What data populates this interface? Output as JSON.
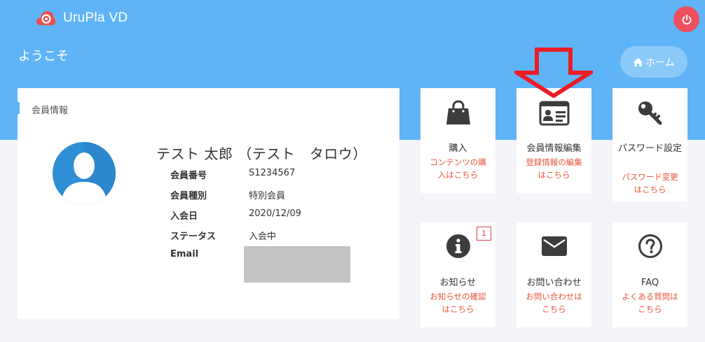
{
  "app": {
    "name": "UruPla VD"
  },
  "header": {
    "welcome": "ようこそ",
    "home_label": "ホーム"
  },
  "member_card": {
    "title": "会員情報",
    "name": "テスト 太郎 （テスト　タロウ）",
    "fields": [
      {
        "label": "会員番号",
        "value": "S1234567"
      },
      {
        "label": "会員種別",
        "value": "特別会員"
      },
      {
        "label": "入会日",
        "value": "2020/12/09"
      },
      {
        "label": "ステータス",
        "value": "入会中"
      },
      {
        "label": "Email",
        "value": ""
      }
    ]
  },
  "tiles": [
    {
      "id": "purchase",
      "icon": "shopping-bag-icon",
      "label": "購入",
      "desc": "コンテンツの購入はこちら"
    },
    {
      "id": "member-edit",
      "icon": "id-card-icon",
      "label": "会員情報編集",
      "desc": "登録情報の編集はこちら"
    },
    {
      "id": "password",
      "icon": "key-icon",
      "label": "パスワード設定",
      "desc": "パスワード変更はこちら"
    },
    {
      "id": "notice",
      "icon": "info-circle-icon",
      "label": "お知らせ",
      "desc": "お知らせの確認はこちら",
      "badge": "1"
    },
    {
      "id": "contact",
      "icon": "envelope-icon",
      "label": "お問い合わせ",
      "desc": "お問い合わせはこちら"
    },
    {
      "id": "faq",
      "icon": "question-circle-icon",
      "label": "FAQ",
      "desc": "よくある質問はこちら"
    }
  ],
  "colors": {
    "primary": "#5fb4f7",
    "accent_red": "#e8553b",
    "power": "#ef4f5f",
    "icon_dark": "#3c3c3c"
  }
}
